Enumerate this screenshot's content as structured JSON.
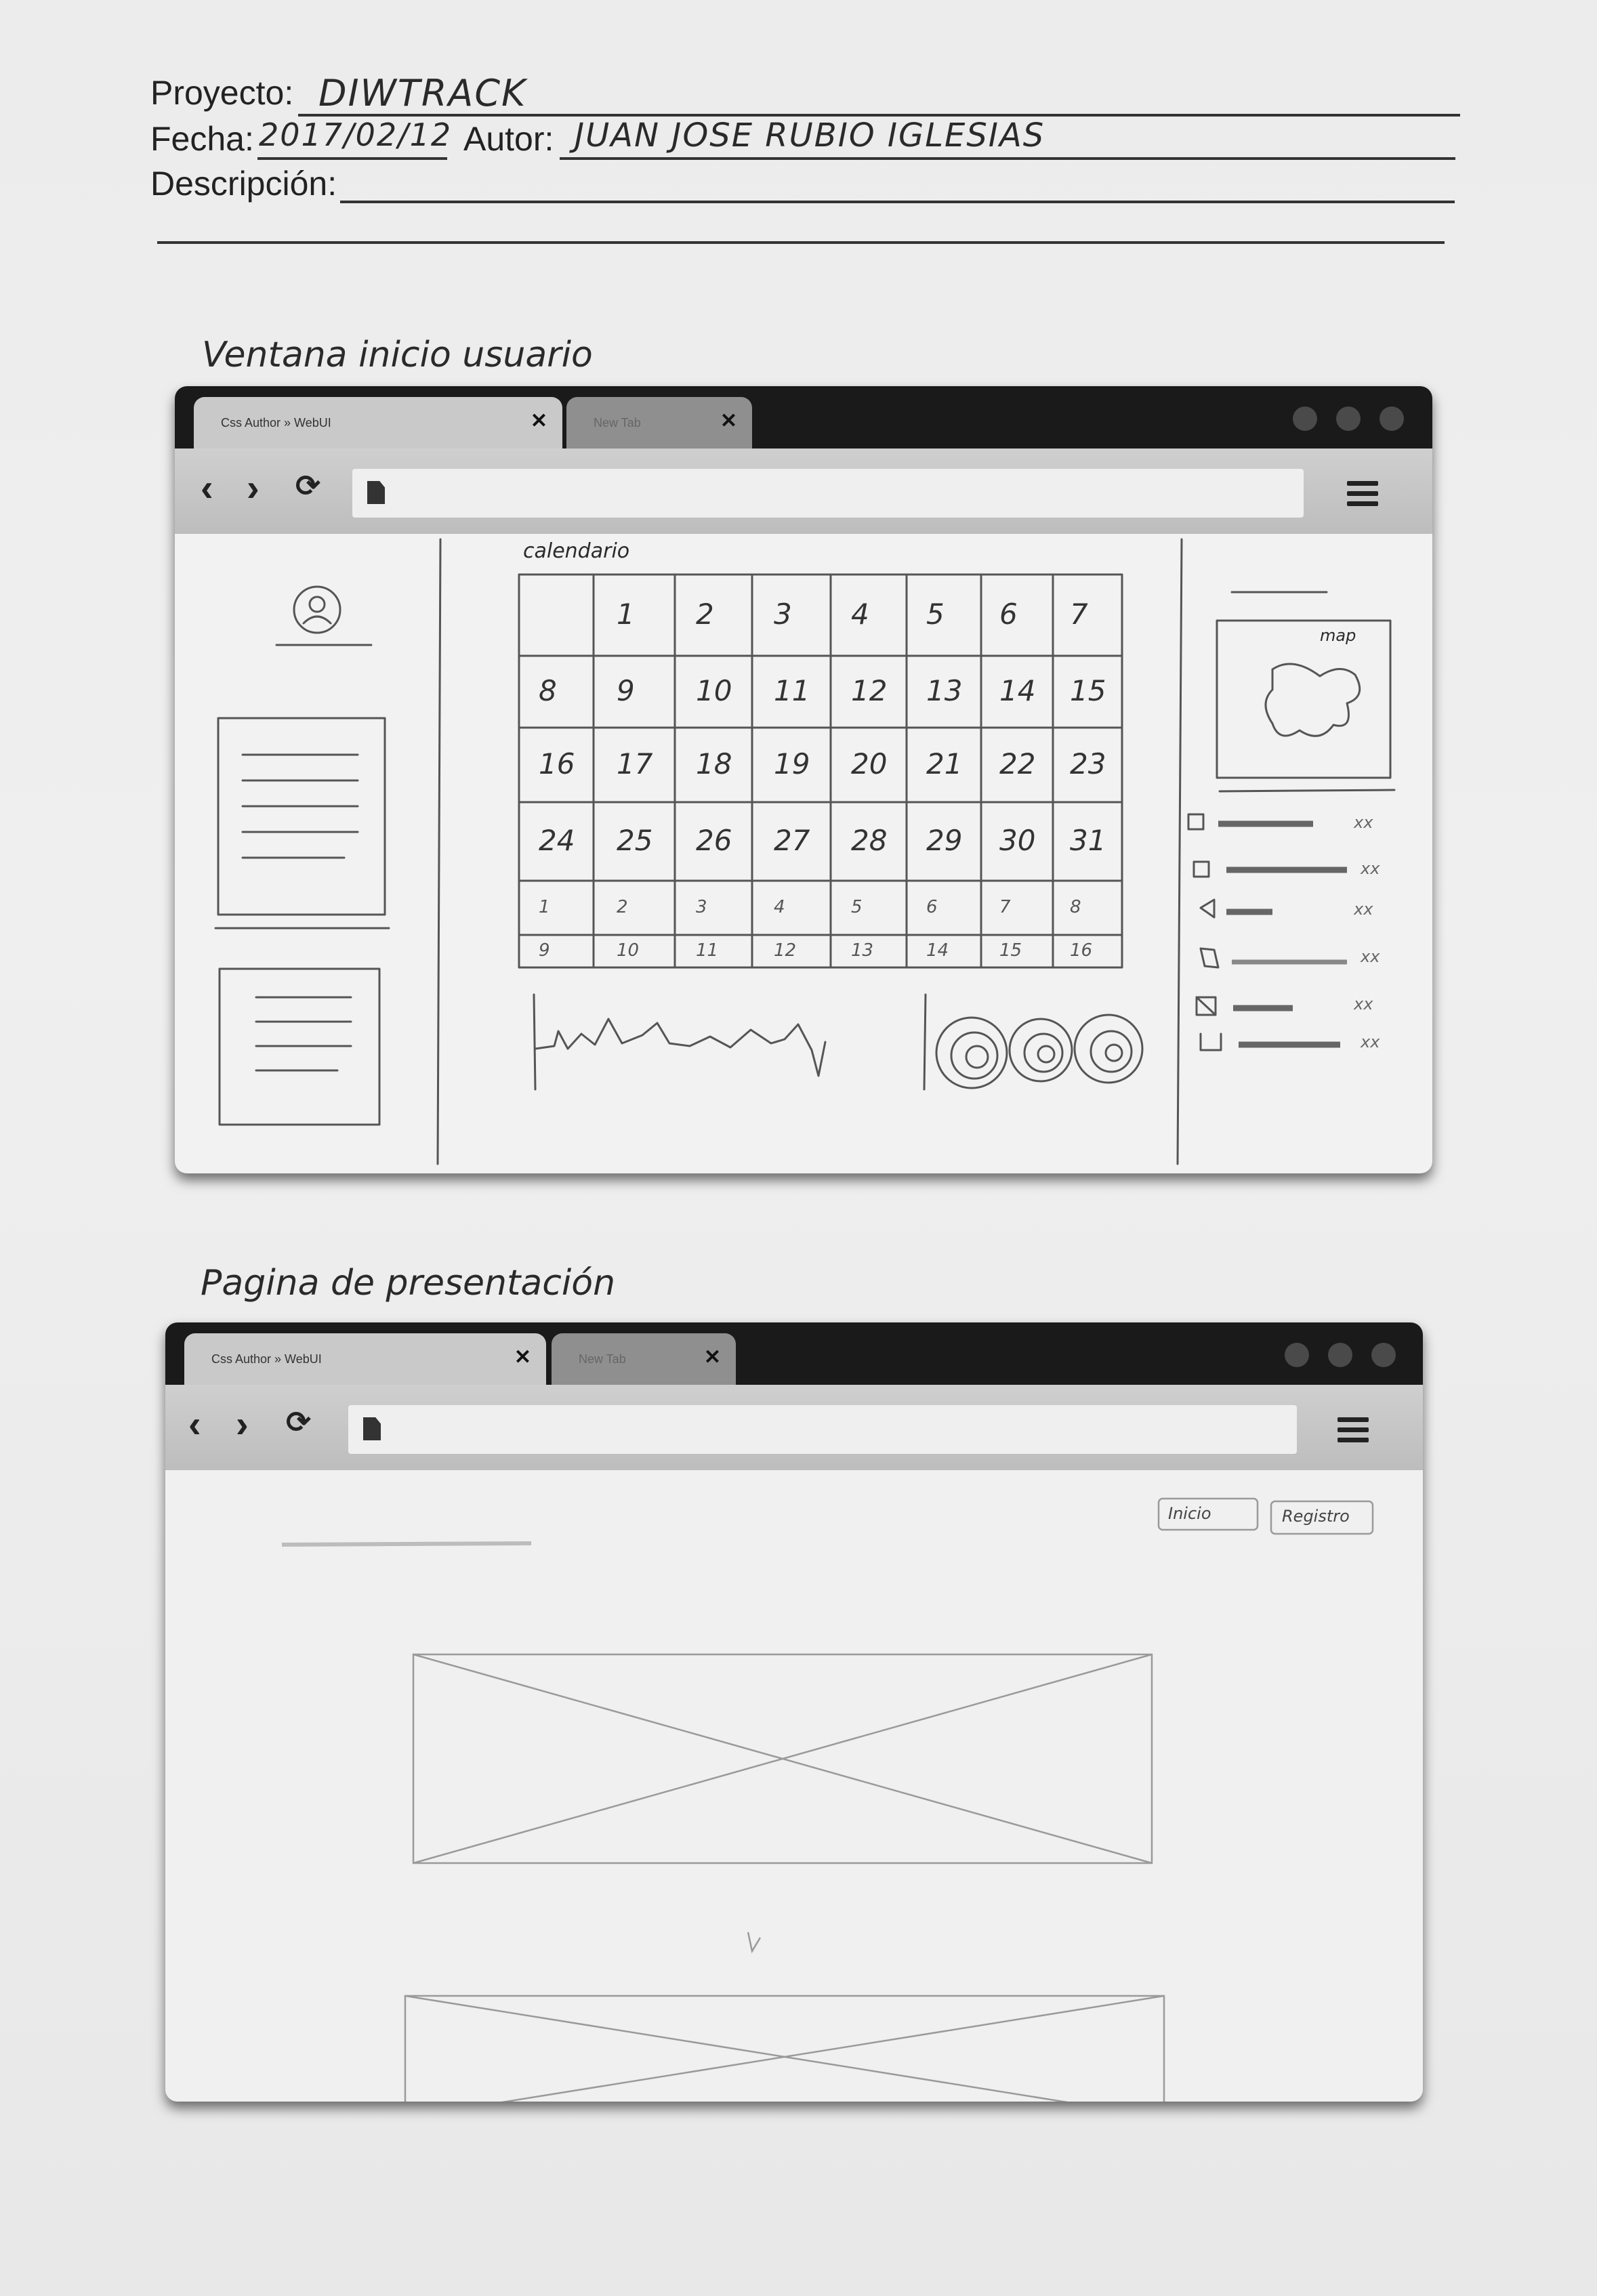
{
  "header": {
    "proyecto_label": "Proyecto:",
    "proyecto_value": "DIWTRACK",
    "fecha_label": "Fecha:",
    "fecha_value": "2017/02/12",
    "autor_label": "Autor:",
    "autor_value": "JUAN JOSE RUBIO IGLESIAS",
    "descripcion_label": "Descripción:"
  },
  "sketch1": {
    "caption": "Ventana inicio usuario",
    "tab1_label": "Css Author » WebUI",
    "tab2_label": "New Tab",
    "calendar_label": "calendario",
    "map_label": "map",
    "calendar_rows": [
      [
        "",
        "1",
        "2",
        "3",
        "4",
        "5",
        "6",
        "7"
      ],
      [
        "8",
        "9",
        "10",
        "11",
        "12",
        "13",
        "14",
        "15"
      ],
      [
        "16",
        "17",
        "18",
        "19",
        "20",
        "21",
        "22",
        "23"
      ],
      [
        "24",
        "25",
        "26",
        "27",
        "28",
        "29",
        "30",
        "31"
      ],
      [
        "1",
        "2",
        "3",
        "4",
        "5",
        "6",
        "7",
        "8"
      ],
      [
        "9",
        "10",
        "11",
        "12",
        "13",
        "14",
        "15",
        "16"
      ]
    ],
    "list_suffixes": [
      "xx",
      "xx",
      "xx",
      "xx",
      "xx",
      "xx"
    ]
  },
  "sketch2": {
    "caption": "Pagina de presentación",
    "tab1_label": "Css Author » WebUI",
    "tab2_label": "New Tab",
    "button1": "Inicio",
    "button2": "Registro"
  }
}
